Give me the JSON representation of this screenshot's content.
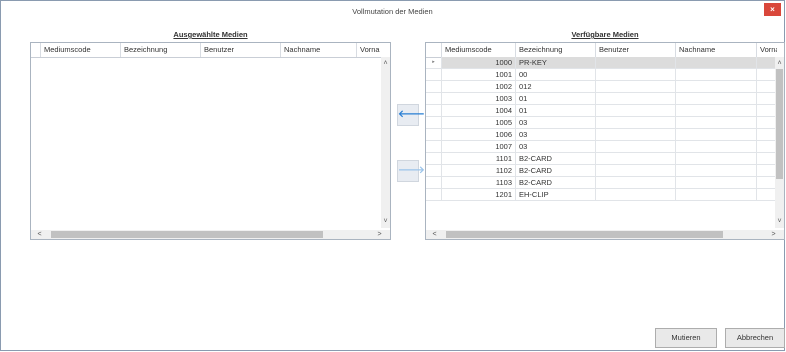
{
  "window": {
    "title": "Vollmutation der Medien",
    "close_glyph": "×"
  },
  "left_panel": {
    "title": "Ausgewählte Medien",
    "columns": [
      "Mediumscode",
      "Bezeichnung",
      "Benutzer",
      "Nachname",
      "Vorna"
    ],
    "rows": []
  },
  "right_panel": {
    "title": "Verfügbare Medien",
    "columns": [
      "Mediumscode",
      "Bezeichnung",
      "Benutzer",
      "Nachname",
      "Vorna"
    ],
    "current_row_glyph": "▸",
    "rows": [
      {
        "code": "1000",
        "name": "PR-KEY"
      },
      {
        "code": "1001",
        "name": "00"
      },
      {
        "code": "1002",
        "name": "012"
      },
      {
        "code": "1003",
        "name": "01"
      },
      {
        "code": "1004",
        "name": "01"
      },
      {
        "code": "1005",
        "name": "03"
      },
      {
        "code": "1006",
        "name": "03"
      },
      {
        "code": "1007",
        "name": "03"
      },
      {
        "code": "1101",
        "name": "B2-CARD"
      },
      {
        "code": "1102",
        "name": "B2-CARD"
      },
      {
        "code": "1103",
        "name": "B2-CARD"
      },
      {
        "code": "1201",
        "name": "EH-CLIP"
      }
    ]
  },
  "move_buttons": {
    "left_glyph": "🡐",
    "right_glyph": "🡒",
    "left_color": "#2a7fd4",
    "right_color": "#9cc4ea"
  },
  "scroll_glyphs": {
    "up": "˄",
    "down": "˅",
    "left": "<",
    "right": ">"
  },
  "buttons": {
    "confirm": "Mutieren",
    "cancel": "Abbrechen"
  }
}
